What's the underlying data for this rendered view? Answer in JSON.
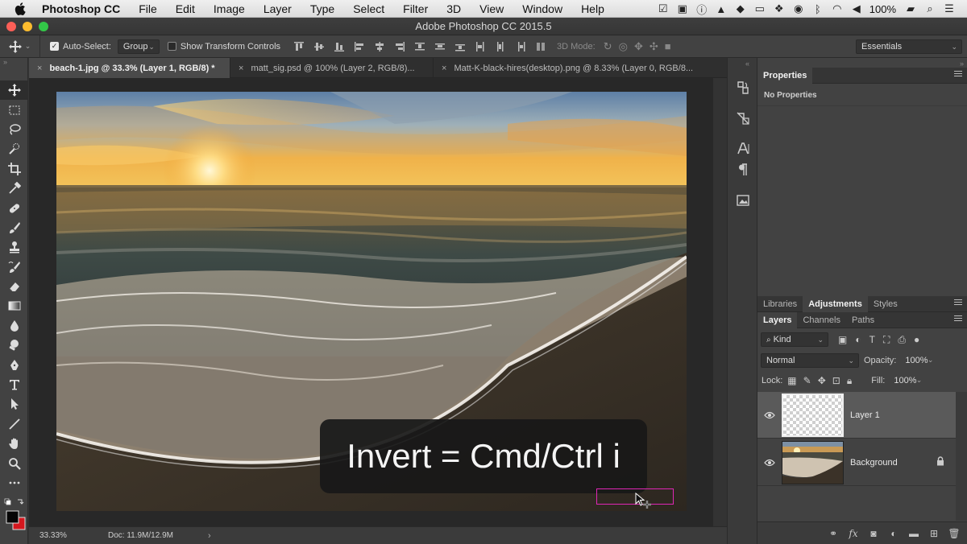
{
  "menubar": {
    "app_name": "Photoshop CC",
    "items": [
      "File",
      "Edit",
      "Image",
      "Layer",
      "Type",
      "Select",
      "Filter",
      "3D",
      "View",
      "Window",
      "Help"
    ],
    "battery": "100%"
  },
  "window": {
    "title": "Adobe Photoshop CC 2015.5"
  },
  "options": {
    "auto_select_label": "Auto-Select:",
    "auto_select_value": "Group",
    "transform_label": "Show Transform Controls",
    "mode_3d_label": "3D Mode:",
    "workspace": "Essentials"
  },
  "doc_tabs": [
    {
      "label": "beach-1.jpg @ 33.3% (Layer 1, RGB/8) *"
    },
    {
      "label": "matt_sig.psd @ 100% (Layer 2, RGB/8)..."
    },
    {
      "label": "Matt-K-black-hires(desktop).png @ 8.33% (Layer 0, RGB/8..."
    }
  ],
  "caption": "Invert = Cmd/Ctrl i",
  "status": {
    "zoom": "33.33%",
    "doc": "Doc: 11.9M/12.9M"
  },
  "properties": {
    "tab": "Properties",
    "empty_text": "No Properties"
  },
  "mid_tabs": [
    "Libraries",
    "Adjustments",
    "Styles"
  ],
  "layers_tabs": [
    "Layers",
    "Channels",
    "Paths"
  ],
  "layers": {
    "kind_label": "Kind",
    "blend_mode": "Normal",
    "opacity_label": "Opacity:",
    "opacity_value": "100%",
    "lock_label": "Lock:",
    "fill_label": "Fill:",
    "fill_value": "100%",
    "items": [
      {
        "name": "Layer 1"
      },
      {
        "name": "Background"
      }
    ]
  }
}
